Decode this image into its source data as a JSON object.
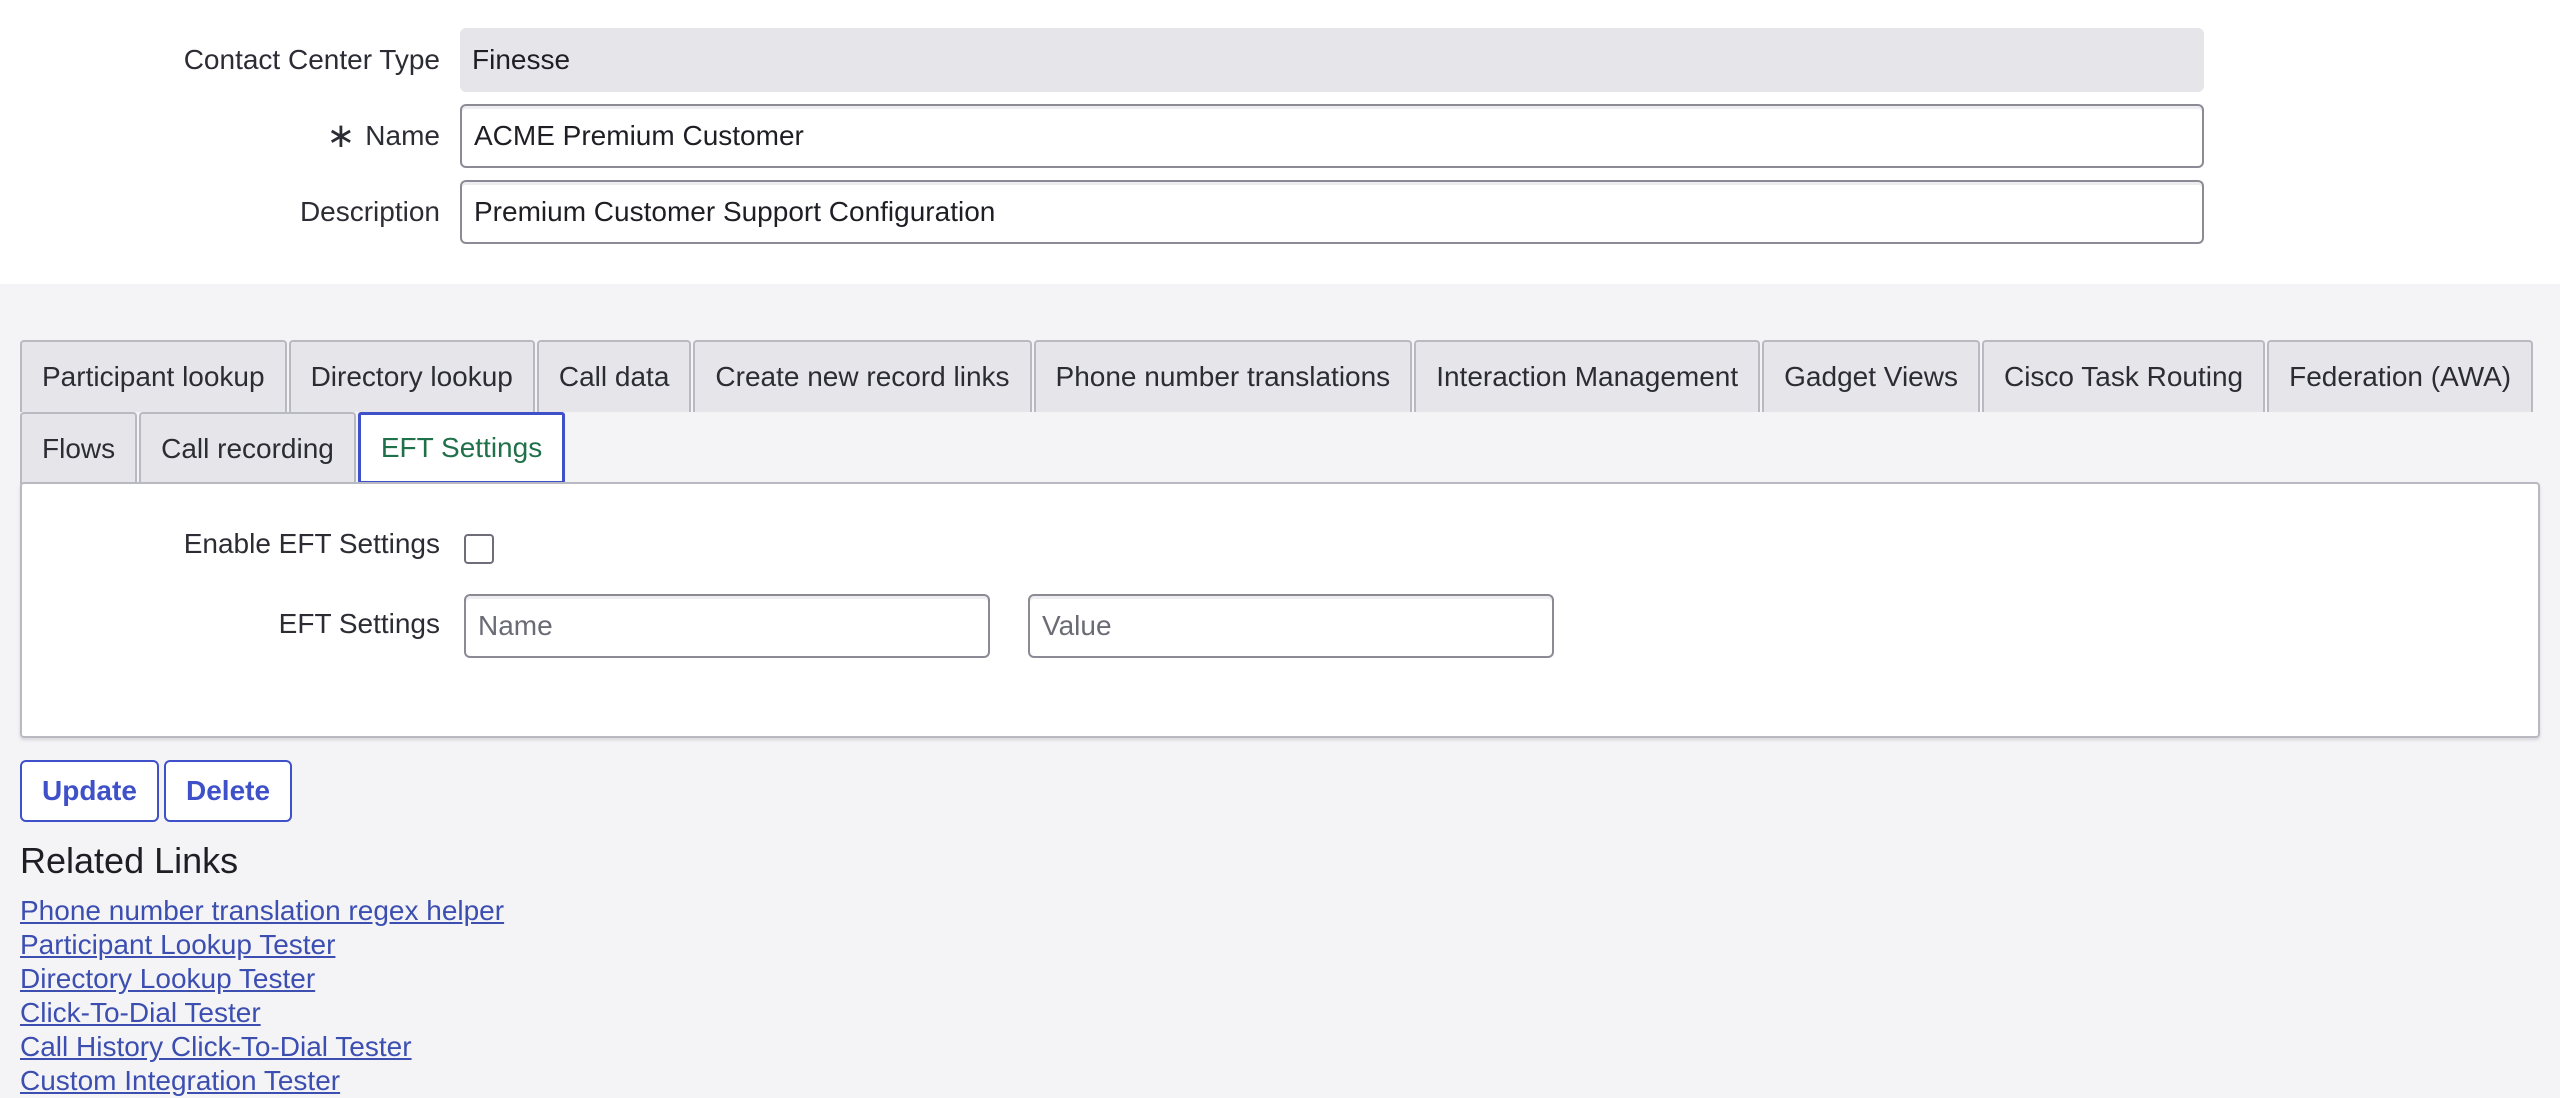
{
  "form": {
    "contact_center_type": {
      "label": "Contact Center Type",
      "value": "Finesse"
    },
    "name": {
      "required_mark": "∗",
      "label": "Name",
      "value": "ACME Premium Customer"
    },
    "description": {
      "label": "Description",
      "value": "Premium Customer Support Configuration"
    }
  },
  "tabs": {
    "row1": [
      {
        "label": "Participant lookup"
      },
      {
        "label": "Directory lookup"
      },
      {
        "label": "Call data"
      },
      {
        "label": "Create new record links"
      },
      {
        "label": "Phone number translations"
      },
      {
        "label": "Interaction Management"
      },
      {
        "label": "Gadget Views"
      },
      {
        "label": "Cisco Task Routing"
      },
      {
        "label": "Federation (AWA)"
      }
    ],
    "row2": [
      {
        "label": "Flows"
      },
      {
        "label": "Call recording"
      },
      {
        "label": "EFT Settings",
        "active": true
      }
    ]
  },
  "eft_panel": {
    "enable_label": "Enable EFT Settings",
    "enable_checked": false,
    "settings_label": "EFT Settings",
    "name_placeholder": "Name",
    "value_placeholder": "Value"
  },
  "actions": {
    "update_label": "Update",
    "delete_label": "Delete"
  },
  "related_links": {
    "title": "Related Links",
    "items": [
      "Phone number translation regex helper",
      "Participant Lookup Tester",
      "Directory Lookup Tester",
      "Click-To-Dial Tester",
      "Call History Click-To-Dial Tester",
      "Custom Integration Tester"
    ]
  },
  "colors": {
    "accent": "#3f51c8",
    "active_tab_text": "#20704a",
    "link": "#3c4eb0",
    "page_bg": "#f4f4f7"
  }
}
